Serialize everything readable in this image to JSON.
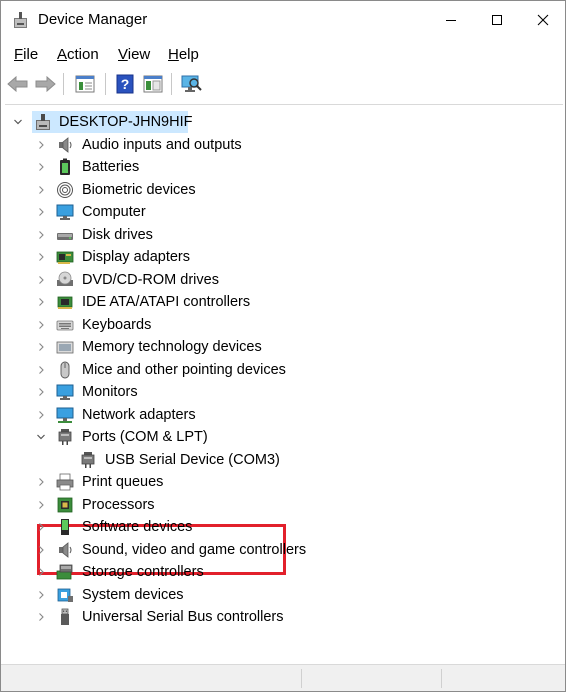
{
  "window": {
    "title": "Device Manager",
    "minimize_icon": "minimize-icon",
    "maximize_icon": "maximize-icon",
    "close_icon": "close-icon"
  },
  "menu": {
    "items": [
      {
        "accel": "F",
        "rest": "ile"
      },
      {
        "accel": "A",
        "rest": "ction"
      },
      {
        "accel": "V",
        "rest": "iew"
      },
      {
        "accel": "H",
        "rest": "elp"
      }
    ]
  },
  "toolbar": {
    "buttons": [
      "back-arrow-icon",
      "forward-arrow-icon",
      "properties-icon",
      "help-icon",
      "show-hide-console-tree-icon",
      "scan-hardware-icon"
    ]
  },
  "tree": {
    "root": {
      "label": "DESKTOP-JHN9HIF",
      "icon": "computer-tower-icon"
    },
    "categories": [
      {
        "label": "Audio inputs and outputs",
        "icon": "speaker-icon"
      },
      {
        "label": "Batteries",
        "icon": "battery-icon"
      },
      {
        "label": "Biometric devices",
        "icon": "fingerprint-icon"
      },
      {
        "label": "Computer",
        "icon": "monitor-icon"
      },
      {
        "label": "Disk drives",
        "icon": "disk-drive-icon"
      },
      {
        "label": "Display adapters",
        "icon": "display-adapter-icon"
      },
      {
        "label": "DVD/CD-ROM drives",
        "icon": "optical-drive-icon"
      },
      {
        "label": "IDE ATA/ATAPI controllers",
        "icon": "ide-controller-icon"
      },
      {
        "label": "Keyboards",
        "icon": "keyboard-icon"
      },
      {
        "label": "Memory technology devices",
        "icon": "memory-icon"
      },
      {
        "label": "Mice and other pointing devices",
        "icon": "mouse-icon"
      },
      {
        "label": "Monitors",
        "icon": "monitor-icon"
      },
      {
        "label": "Network adapters",
        "icon": "network-icon"
      },
      {
        "label": "Ports (COM & LPT)",
        "icon": "port-icon",
        "expanded": true,
        "children": [
          {
            "label": "USB Serial Device (COM3)",
            "icon": "port-icon"
          }
        ]
      },
      {
        "label": "Print queues",
        "icon": "printer-icon"
      },
      {
        "label": "Processors",
        "icon": "processor-icon"
      },
      {
        "label": "Software devices",
        "icon": "software-device-icon"
      },
      {
        "label": "Sound, video and game controllers",
        "icon": "speaker-icon"
      },
      {
        "label": "Storage controllers",
        "icon": "storage-controller-icon"
      },
      {
        "label": "System devices",
        "icon": "system-device-icon"
      },
      {
        "label": "Universal Serial Bus controllers",
        "icon": "usb-icon"
      }
    ]
  },
  "colors": {
    "selection": "#cce8ff",
    "highlight_box": "#e2202b",
    "accent": "#1e78d2"
  }
}
